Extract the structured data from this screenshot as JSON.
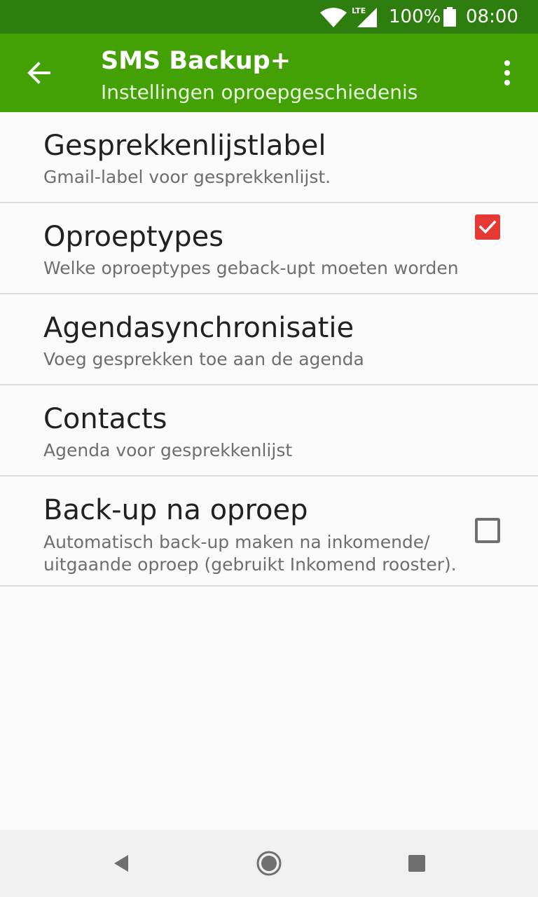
{
  "status_bar": {
    "network": "LTE",
    "battery_percent": "100%",
    "time": "08:00"
  },
  "app_bar": {
    "title": "SMS Backup+",
    "subtitle": "Instellingen oproepgeschiedenis",
    "back_icon": "arrow-back-icon",
    "menu_icon": "more-vert-icon",
    "color": "#43a005"
  },
  "preferences": [
    {
      "title": "Gesprekkenlijstlabel",
      "summary": "Gmail-label voor gesprekkenlijst."
    },
    {
      "title": "Oproeptypes",
      "summary": "Welke oproeptypes geback-upt moeten worden"
    },
    {
      "title": "Agendasynchronisatie",
      "summary": "Voeg gesprekken toe aan de agenda",
      "checked": true
    },
    {
      "title": "Contacts",
      "summary": "Agenda voor gesprekkenlijst"
    },
    {
      "title": "Back-up na oproep",
      "summary": "Automatisch back-up maken na inkomende/ uitgaande oproep (gebruikt Inkomend rooster).",
      "checked": false
    }
  ],
  "accent_color": "#e53935",
  "nav_bar": {
    "back_icon": "nav-back-triangle-icon",
    "home_icon": "nav-home-circle-icon",
    "recents_icon": "nav-recents-square-icon"
  }
}
